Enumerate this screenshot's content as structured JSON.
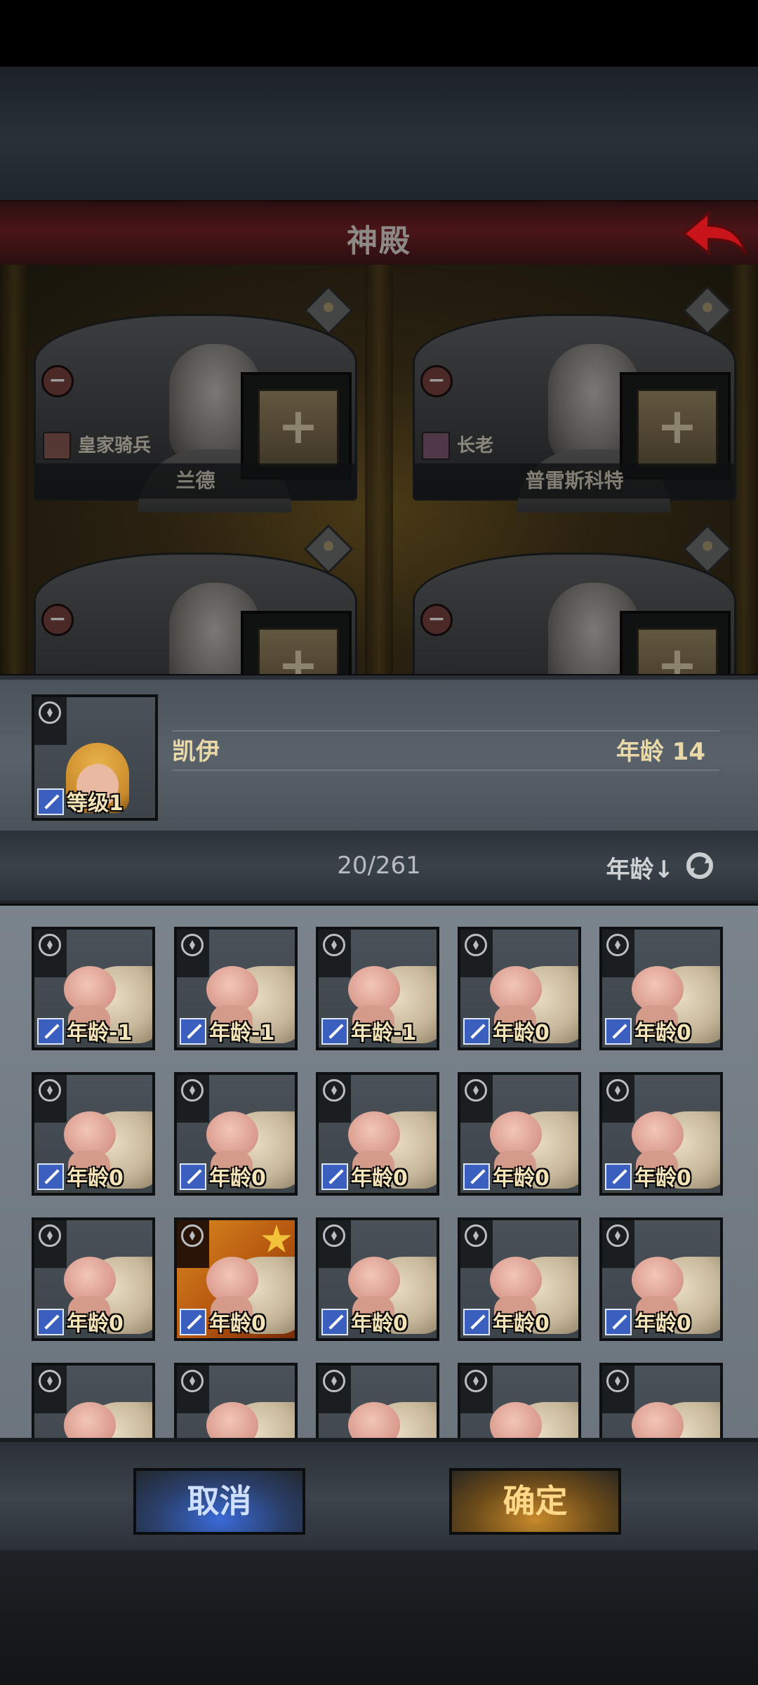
{
  "title": "神殿",
  "cards": [
    {
      "class_label": "皇家骑兵",
      "name": "兰德",
      "class_color": "#c24a3a"
    },
    {
      "class_label": "长老",
      "name": "普雷斯科特",
      "class_color": "#b04a8a"
    },
    {
      "class_label": "",
      "name": "",
      "class_color": "#c2702a"
    },
    {
      "class_label": "",
      "name": "",
      "class_color": "#c2702a"
    }
  ],
  "selected": {
    "level": "等级1",
    "name": "凯伊",
    "age": "年龄 14"
  },
  "sort_bar": {
    "count": "20/261",
    "sort_label": "年龄↓"
  },
  "babies": [
    {
      "age": "年龄-1",
      "starred": false
    },
    {
      "age": "年龄-1",
      "starred": false
    },
    {
      "age": "年龄-1",
      "starred": false
    },
    {
      "age": "年龄0",
      "starred": false
    },
    {
      "age": "年龄0",
      "starred": false
    },
    {
      "age": "年龄0",
      "starred": false
    },
    {
      "age": "年龄0",
      "starred": false
    },
    {
      "age": "年龄0",
      "starred": false
    },
    {
      "age": "年龄0",
      "starred": false
    },
    {
      "age": "年龄0",
      "starred": false
    },
    {
      "age": "年龄0",
      "starred": false
    },
    {
      "age": "年龄0",
      "starred": true
    },
    {
      "age": "年龄0",
      "starred": false
    },
    {
      "age": "年龄0",
      "starred": false
    },
    {
      "age": "年龄0",
      "starred": false
    },
    {
      "age": "",
      "starred": false
    },
    {
      "age": "",
      "starred": false
    },
    {
      "age": "",
      "starred": false
    },
    {
      "age": "",
      "starred": false
    },
    {
      "age": "",
      "starred": false
    }
  ],
  "buttons": {
    "cancel": "取消",
    "confirm": "确定"
  }
}
